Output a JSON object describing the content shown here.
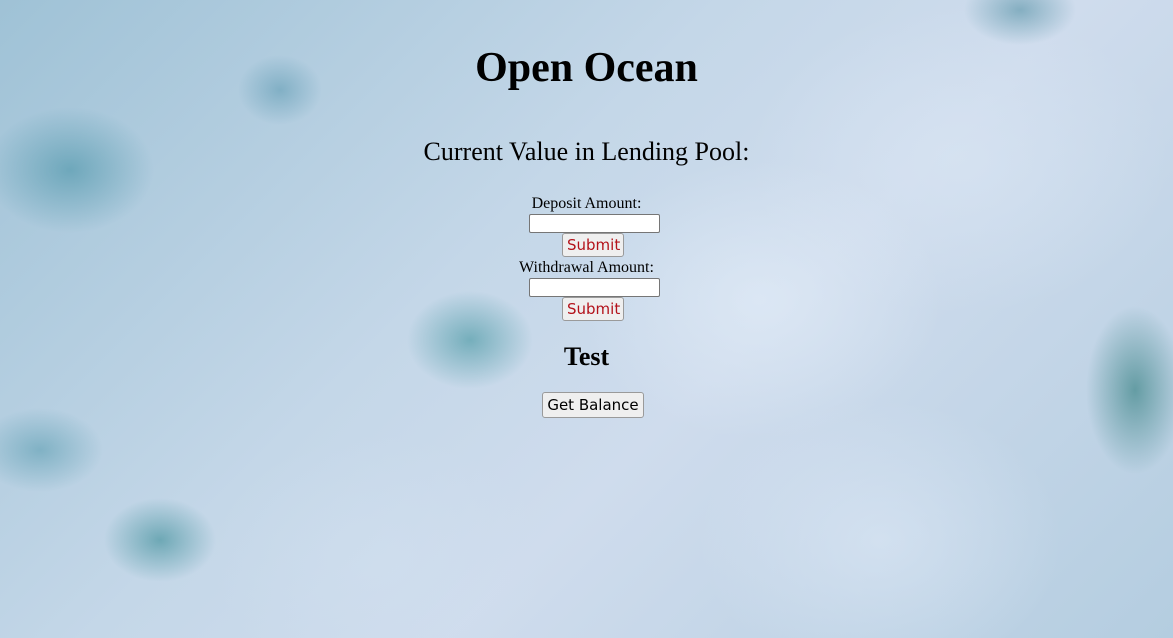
{
  "page": {
    "title": "Open Ocean",
    "pool_label": "Current Value in Lending Pool:"
  },
  "deposit": {
    "label": "Deposit Amount:",
    "value": "",
    "submit_label": "Submit"
  },
  "withdrawal": {
    "label": "Withdrawal Amount:",
    "value": "",
    "submit_label": "Submit"
  },
  "test": {
    "heading": "Test",
    "balance_button_label": "Get Balance"
  },
  "colors": {
    "submit_text": "#b3121a",
    "background": "ocean-water-texture"
  }
}
